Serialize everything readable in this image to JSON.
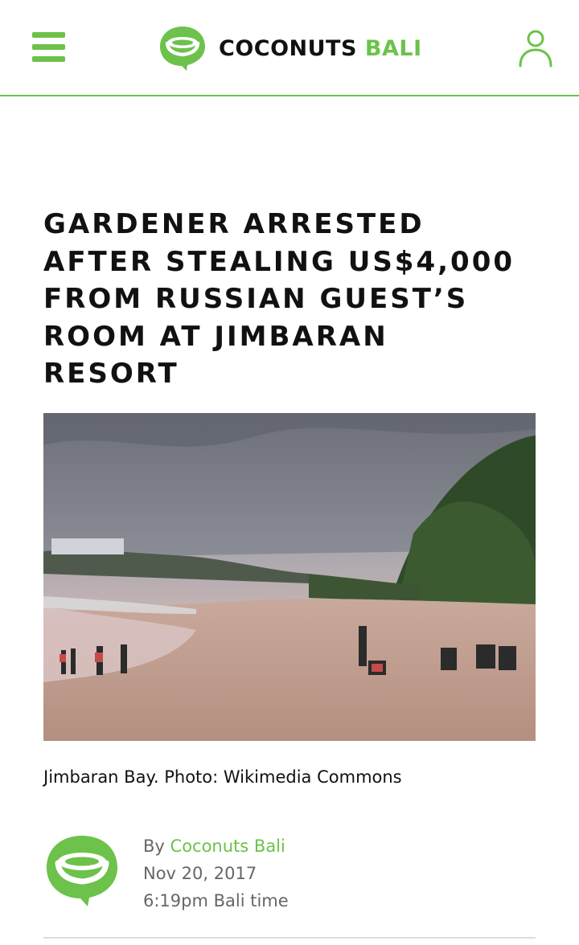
{
  "header": {
    "brand_primary": "COCONUTS",
    "brand_secondary": "BALI"
  },
  "article": {
    "headline": "GARDENER ARRESTED AFTER STEALING US$4,000 FROM RUSSIAN GUEST’S ROOM AT JIMBARAN RESORT",
    "image_caption": "Jimbaran Bay. Photo: Wikimedia Commons",
    "byline_prefix": "By",
    "author": "Coconuts Bali",
    "date": "Nov 20, 2017",
    "time": "6:19pm Bali time"
  },
  "colors": {
    "accent": "#6cc24a",
    "text": "#111111",
    "muted": "#666666",
    "divider": "#dddddd"
  },
  "icons": {
    "menu": "hamburger-menu-icon",
    "logo": "coconut-speech-bubble-logo",
    "user": "user-profile-icon"
  }
}
